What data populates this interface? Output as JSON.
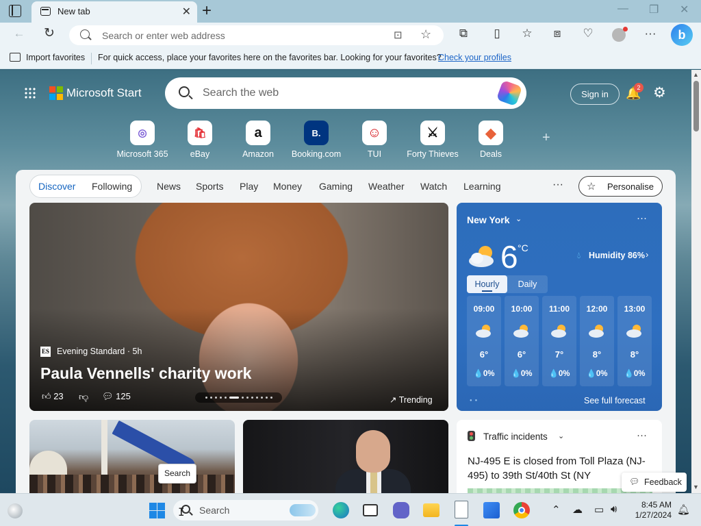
{
  "browser": {
    "tab_title": "New tab",
    "tab_close": "✕",
    "new_tab": "+",
    "window_controls": {
      "minimize": "—",
      "restore": "❐",
      "close": "✕"
    },
    "address_placeholder": "Search or enter web address",
    "favorites_bar": {
      "import_label": "Import favorites",
      "message": "For quick access, place your favorites here on the favorites bar. Looking for your favorites?",
      "link": "Check your profiles"
    }
  },
  "start": {
    "brand": "Microsoft Start",
    "search_placeholder": "Search the web",
    "sign_in": "Sign in",
    "notification_count": "2",
    "quick_links": [
      {
        "label": "Microsoft 365",
        "glyph": "◎",
        "color": "#7b5cd6"
      },
      {
        "label": "eBay",
        "glyph": "🛍",
        "color": "#e53238"
      },
      {
        "label": "Amazon",
        "glyph": "a",
        "color": "#111111"
      },
      {
        "label": "Booking.com",
        "glyph": "B.",
        "color": "#003580"
      },
      {
        "label": "TUI",
        "glyph": "☺",
        "color": "#d40e14"
      },
      {
        "label": "Forty Thieves",
        "glyph": "⚔",
        "color": "#111111"
      },
      {
        "label": "Deals",
        "glyph": "◆",
        "color": "#e8623a"
      }
    ],
    "add_link": "+"
  },
  "feed": {
    "nav": [
      "Discover",
      "Following",
      "News",
      "Sports",
      "Play",
      "Money",
      "Gaming",
      "Weather",
      "Watch",
      "Learning"
    ],
    "more": "···",
    "personalise": "Personalise",
    "hero": {
      "source_icon": "ES",
      "source": "Evening Standard · 5h",
      "title": "Paula Vennells' charity work",
      "likes": "23",
      "comments": "125",
      "trending": "Trending"
    },
    "weather": {
      "city": "New York",
      "temperature": "6",
      "unit": "°C",
      "humidity": "Humidity 86%",
      "tabs": [
        "Hourly",
        "Daily"
      ],
      "hours": [
        {
          "time": "09:00",
          "temp": "6°",
          "rain": "💧0%"
        },
        {
          "time": "10:00",
          "temp": "6°",
          "rain": "💧0%"
        },
        {
          "time": "11:00",
          "temp": "7°",
          "rain": "💧0%"
        },
        {
          "time": "12:00",
          "temp": "8°",
          "rain": "💧0%"
        },
        {
          "time": "13:00",
          "temp": "8°",
          "rain": "💧0%"
        }
      ],
      "forecast_link": "See full forecast"
    },
    "traffic": {
      "title": "Traffic incidents",
      "text": "NJ-495 E is closed from Toll Plaza (NJ-495) to 39th St/40th St (NY"
    },
    "feedback": "Feedback",
    "tooltip": "Search"
  },
  "taskbar": {
    "search_placeholder": "Search",
    "time": "8:45 AM",
    "date": "1/27/2024"
  }
}
